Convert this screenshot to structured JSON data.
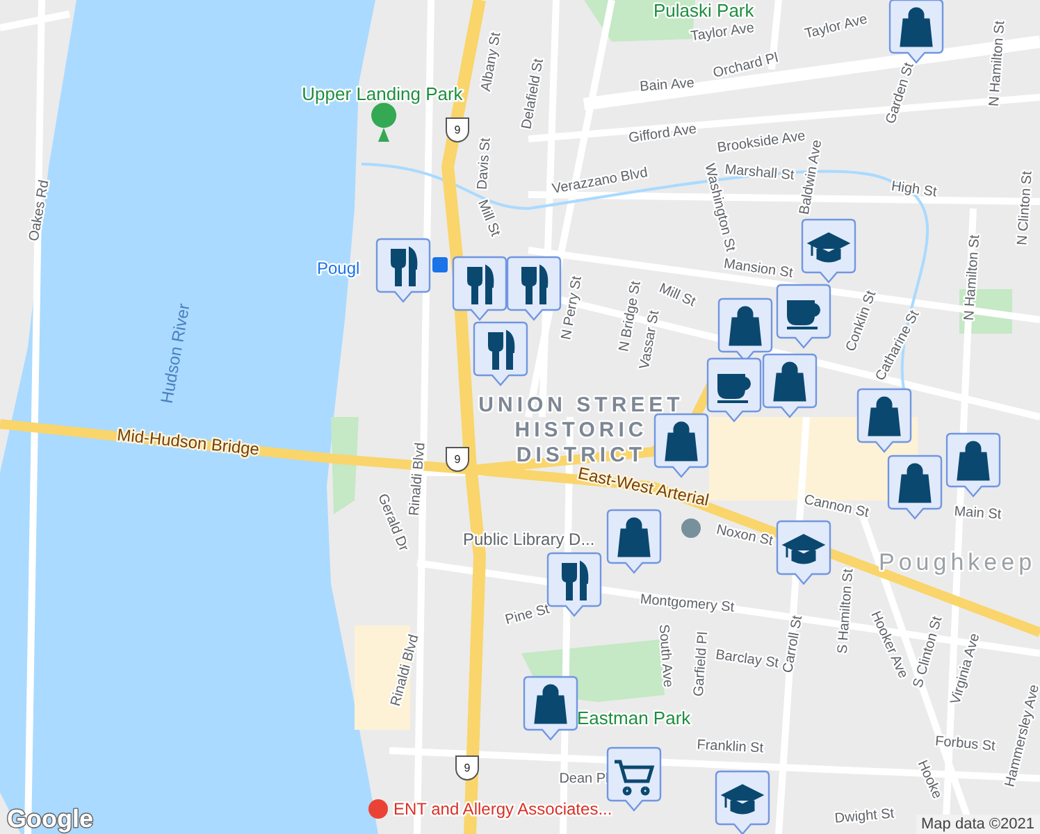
{
  "map": {
    "streets": [
      "Taylor Ave",
      "Taylor Ave",
      "Orchard Pl",
      "Bain Ave",
      "Gifford Ave",
      "Brookside Ave",
      "Verazzano Blvd",
      "Washington St",
      "Marshall St",
      "High St",
      "Delafield St",
      "Albany St",
      "Davis St",
      "Mill St",
      "Mill St",
      "N Perry St",
      "N Bridge St",
      "Vassar St",
      "Baldwin Ave",
      "Mansion St",
      "Garden St",
      "N Hamilton St",
      "N Hamilton St",
      "N Clinton St",
      "Conklin St",
      "Catharine St",
      "Oakes Rd",
      "Gerald Dr",
      "Rinaldi Blvd",
      "Rinaldi Blvd",
      "Cannon St",
      "Main St",
      "Noxon St",
      "Montgomery St",
      "South Ave",
      "Garfield Pl",
      "Carroll St",
      "S Hamilton St",
      "Hooker Ave",
      "Hooke",
      "Barclay St",
      "S Clinton St",
      "Virginia Ave",
      "Hammersley Ave",
      "Forbus St",
      "Franklin St",
      "Pine St",
      "Dean Pl",
      "Dwight St"
    ],
    "highways": [
      "Mid-Hudson Bridge",
      "East-West Arterial"
    ],
    "water": [
      "Hudson River"
    ],
    "parks": [
      "Pulaski Park",
      "Upper Landing Park",
      "Eastman Park"
    ],
    "district": [
      "UNION STREET",
      "HISTORIC",
      "DISTRICT"
    ],
    "city": "Poughkeep",
    "places": [
      {
        "kind": "station",
        "label": "Pougl"
      },
      {
        "kind": "library",
        "label": "Public Library D..."
      },
      {
        "kind": "hospital",
        "label": "ENT and Allergy Associates..."
      }
    ],
    "route_shields": [
      "9",
      "9",
      "9"
    ],
    "markers": [
      {
        "kind": "shopping"
      },
      {
        "kind": "restaurant"
      },
      {
        "kind": "restaurant"
      },
      {
        "kind": "restaurant"
      },
      {
        "kind": "restaurant"
      },
      {
        "kind": "school"
      },
      {
        "kind": "cafe"
      },
      {
        "kind": "shopping"
      },
      {
        "kind": "shopping"
      },
      {
        "kind": "cafe"
      },
      {
        "kind": "shopping"
      },
      {
        "kind": "shopping"
      },
      {
        "kind": "shopping"
      },
      {
        "kind": "shopping"
      },
      {
        "kind": "shopping"
      },
      {
        "kind": "school"
      },
      {
        "kind": "restaurant"
      },
      {
        "kind": "shopping"
      },
      {
        "kind": "grocery"
      },
      {
        "kind": "school"
      }
    ],
    "logo": "Google",
    "attribution": "Map data ©2021"
  }
}
